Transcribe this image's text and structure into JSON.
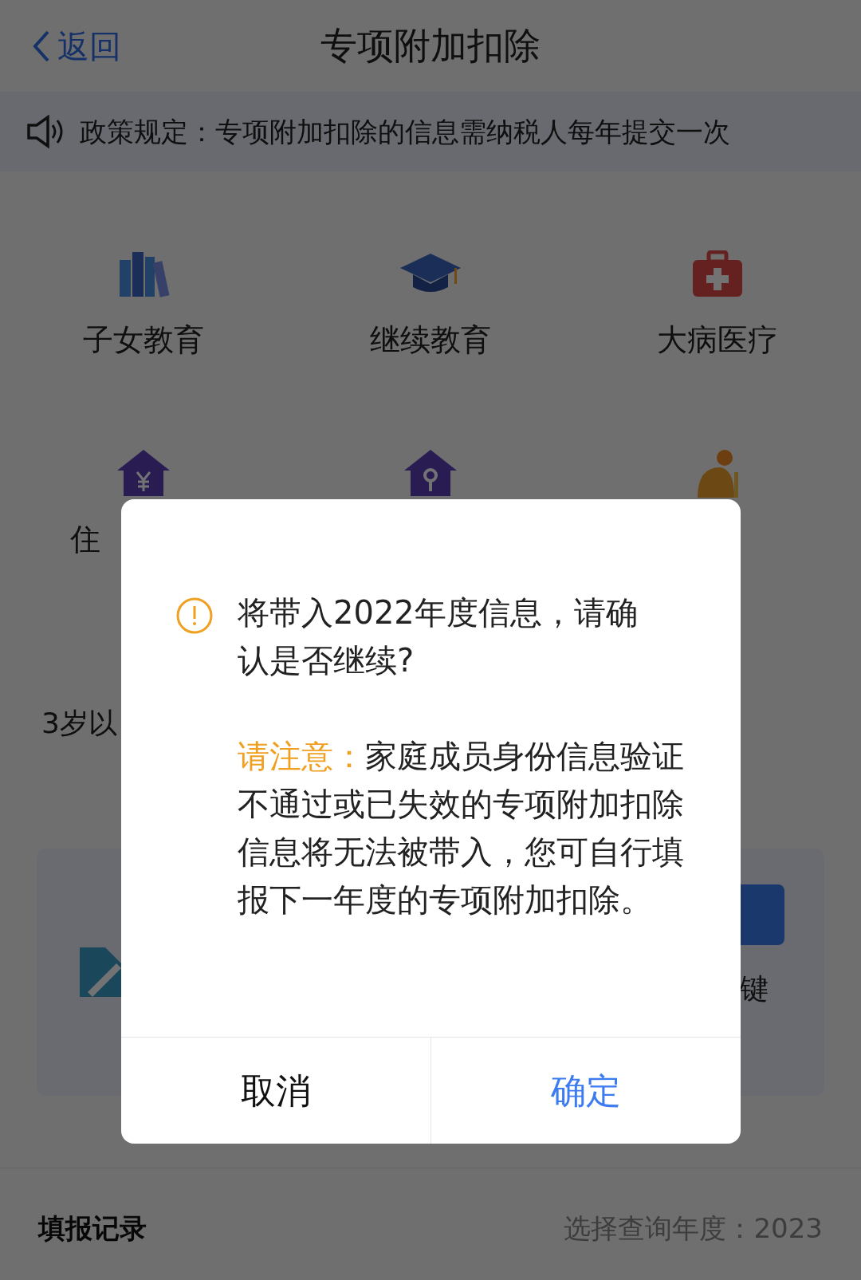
{
  "nav": {
    "back": "返回",
    "title": "专项附加扣除"
  },
  "notice": "政策规定：专项附加扣除的信息需纳税人每年提交一次",
  "categories": [
    {
      "kind": "books",
      "label": "子女教育"
    },
    {
      "kind": "cap",
      "label": "继续教育"
    },
    {
      "kind": "medical",
      "label": "大病医疗"
    },
    {
      "kind": "house-yuan",
      "label": "住"
    },
    {
      "kind": "house-key"
    },
    {
      "kind": "elder"
    }
  ],
  "age_note": "3岁以",
  "card": {
    "right_label": "键"
  },
  "records": {
    "title": "填报记录",
    "year_picker": "选择查询年度：2023"
  },
  "dialog": {
    "message": "将带入2022年度信息，请确认是否继续?",
    "note_label": "请注意：",
    "note": "家庭成员身份信息验证不通过或已失效的专项附加扣除信息将无法被带入，您可自行填报下一年度的专项附加扣除。",
    "buttons": [
      "取消",
      "确定"
    ]
  }
}
